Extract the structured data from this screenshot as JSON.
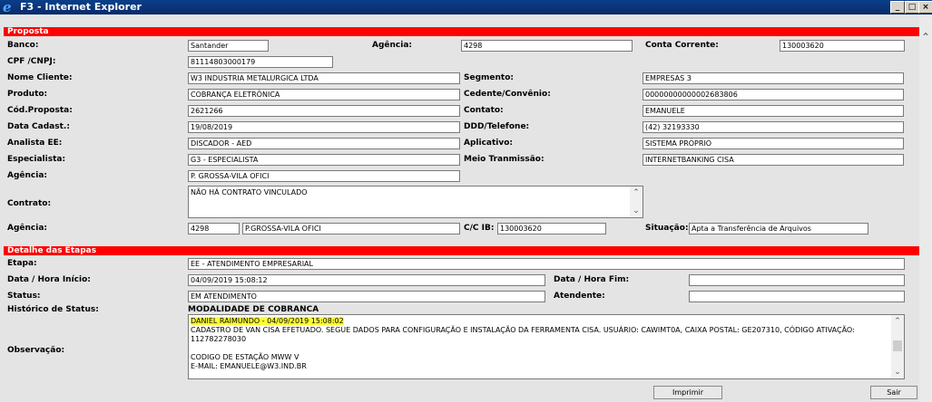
{
  "window": {
    "title": "F3 - Internet Explorer",
    "min_label": "_",
    "max_label": "□",
    "close_label": "×"
  },
  "proposta": {
    "section_title": "Proposta",
    "banco_label": "Banco:",
    "banco": "Santander",
    "agencia_label": "Agência:",
    "agencia": "4298",
    "conta_label": "Conta Corrente:",
    "conta": "130003620",
    "cpf_label": "CPF /CNPJ:",
    "cpf": "81114803000179",
    "nome_label": "Nome Cliente:",
    "nome": "W3 INDUSTRIA METALURGICA LTDA",
    "segmento_label": "Segmento:",
    "segmento": "EMPRESAS 3",
    "produto_label": "Produto:",
    "produto": "COBRANÇA ELETRÔNICA",
    "cedente_label": "Cedente/Convênio:",
    "cedente": "00000000000002683806",
    "codprop_label": "Cód.Proposta:",
    "codprop": "2621266",
    "contato_label": "Contato:",
    "contato": "EMANUELE",
    "data_label": "Data Cadast.:",
    "data": "19/08/2019",
    "ddd_label": "DDD/Telefone:",
    "ddd": "(42) 32193330",
    "analista_label": "Analista EE:",
    "analista": "DISCADOR - AED",
    "aplicativo_label": "Aplicativo:",
    "aplicativo": "SISTEMA PRÓPRIO",
    "especialista_label": "Especialista:",
    "especialista": "G3 - ESPECIALISTA",
    "meio_label": "Meio Tranmissão:",
    "meio": "INTERNETBANKING CISA",
    "agencia2_label": "Agência:",
    "agencia2": "P. GROSSA-VILA OFICI",
    "contrato_label": "Contrato:",
    "contrato": "NÃO HÁ CONTRATO VINCULADO",
    "agencia3_label": "Agência:",
    "agencia3_code": "4298",
    "agencia3_name": "P.GROSSA-VILA OFICI",
    "ccib_label": "C/C IB:",
    "ccib": "130003620",
    "situacao_label": "Situação:",
    "situacao": "Apta a Transferência de Arquivos"
  },
  "etapas": {
    "section_title": "Detalhe das Etapas",
    "etapa_label": "Etapa:",
    "etapa": "EE - ATENDIMENTO EMPRESARIAL",
    "inicio_label": "Data / Hora Início:",
    "inicio": "04/09/2019 15:08:12",
    "fim_label": "Data / Hora Fim:",
    "fim": "",
    "status_label": "Status:",
    "status": "EM ATENDIMENTO",
    "atendente_label": "Atendente:",
    "atendente": "",
    "historico_label": "Histórico de Status:",
    "historico": "MODALIDADE DE COBRANCA",
    "obs_label": "Observação:",
    "obs_line1": "DANIEL RAIMUNDO - 04/09/2019 15:08:02",
    "obs_line2": "CADASTRO DE VAN CISA EFETUADO. SEGUE DADOS PARA CONFIGURAÇÃO E INSTALAÇÃO DA FERRAMENTA CISA. USUÁRIO: CAWIMT0A, CAIXA POSTAL: GE207310, CÓDIGO ATIVAÇÃO:",
    "obs_line3": "112782278030",
    "obs_line4": "CODIGO DE ESTAÇÃO MWW V",
    "obs_line5": "E-MAIL: EMANUELE@W3.IND.BR"
  },
  "buttons": {
    "imprimir": "Imprimir",
    "sair": "Sair"
  },
  "colors": {
    "section_bar": "#ff0000",
    "highlight": "#ffff33",
    "titlebar": "#0a3f8a"
  }
}
